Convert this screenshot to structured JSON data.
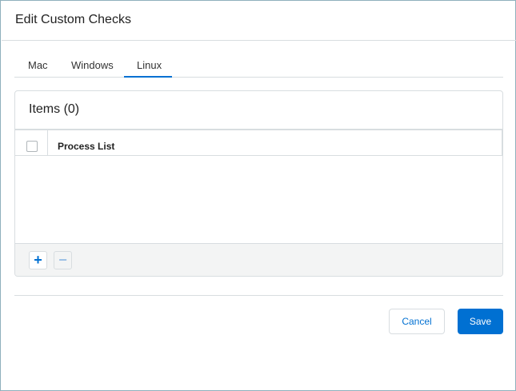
{
  "dialog": {
    "title": "Edit Custom Checks"
  },
  "tabs": [
    {
      "label": "Mac"
    },
    {
      "label": "Windows"
    },
    {
      "label": "Linux",
      "selected": true
    }
  ],
  "panel": {
    "title": "Items (0)",
    "columns": [
      "Process List"
    ],
    "rows": [],
    "add_icon": "+",
    "remove_icon": "−"
  },
  "footer": {
    "cancel_label": "Cancel",
    "save_label": "Save"
  },
  "colors": {
    "accent": "#0070d2"
  }
}
